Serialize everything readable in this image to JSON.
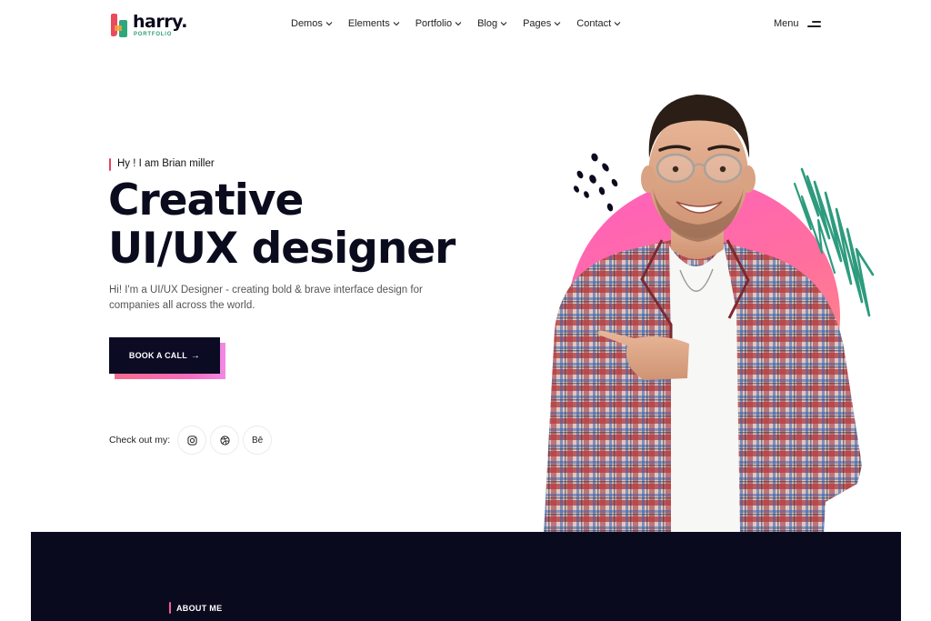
{
  "brand": {
    "name": "harry.",
    "subtitle": "PORTFOLIO",
    "mark_colors": [
      "#e94b5c",
      "#2ea87b"
    ]
  },
  "nav": {
    "items": [
      {
        "label": "Demos",
        "icon": "chevron-down-icon"
      },
      {
        "label": "Elements",
        "icon": "chevron-down-icon"
      },
      {
        "label": "Portfolio",
        "icon": "chevron-down-icon"
      },
      {
        "label": "Blog",
        "icon": "chevron-down-icon"
      },
      {
        "label": "Pages",
        "icon": "chevron-down-icon"
      },
      {
        "label": "Contact",
        "icon": "chevron-down-icon"
      }
    ],
    "menu_label": "Menu",
    "menu_icon": "hamburger-icon"
  },
  "hero": {
    "subtitle": "Hy ! I am Brian miller",
    "title_line1": "Creative",
    "title_line2": "UI/UX designer",
    "description": "Hi! I'm a UI/UX Designer - creating bold & brave interface design for companies all across the world.",
    "cta_label": "BOOK A CALL",
    "cta_icon": "arrow-right-icon",
    "social_label": "Check out my:",
    "social": [
      {
        "name": "instagram-icon"
      },
      {
        "name": "dribbble-icon"
      },
      {
        "name": "behance-icon",
        "text": "Bē"
      }
    ]
  },
  "about": {
    "label": "ABOUT ME"
  },
  "colors": {
    "accent_pink": "#ff5fbf",
    "accent_orange": "#ff9970",
    "accent_green": "#2e9b7e",
    "dark": "#0a0a1f"
  }
}
